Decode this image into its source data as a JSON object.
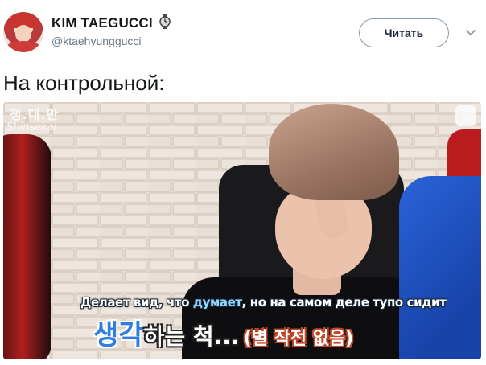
{
  "tweet": {
    "display_name": "KIM TAEGUCCI",
    "name_emoji_icon": "watch-icon",
    "handle": "@ktaehyunggucci",
    "follow_label": "Читать",
    "menu_icon": "chevron-down-icon",
    "text": "На контрольной:"
  },
  "media": {
    "watermark": "정.대.만",
    "watermark_sub": "Shinsekai",
    "caption_ru_part1": "Делает вид, что ",
    "caption_ru_highlight": "думает",
    "caption_ru_part2": ", но на самом деле тупо сидит",
    "caption_kr_main": "생각",
    "caption_kr_rest": "하는 척...",
    "caption_kr_paren": "(별 작전 없음)"
  },
  "colors": {
    "follow_border": "#8899a6",
    "handle": "#657786",
    "caption_highlight": "#8fd9ff",
    "kr_accent": "#2f7de1"
  }
}
